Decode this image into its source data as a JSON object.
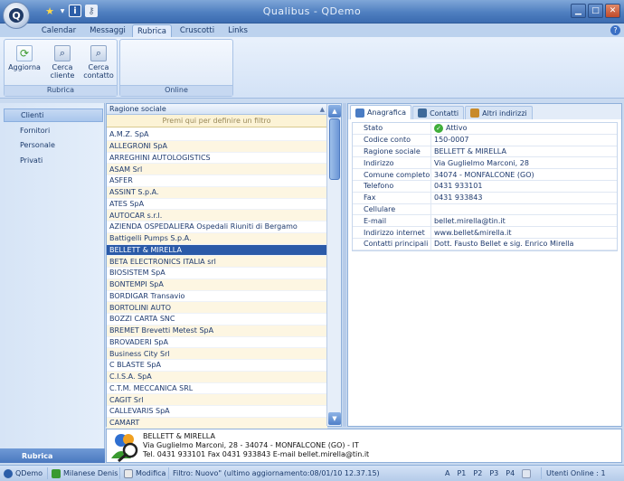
{
  "window": {
    "title": "Qualibus   -   QDemo"
  },
  "menu_tabs": [
    "Calendar",
    "Messaggi",
    "Rubrica",
    "Cruscotti",
    "Links"
  ],
  "ribbon": {
    "group_rubrica": {
      "label": "Rubrica",
      "buttons": [
        "Aggiorna",
        "Cerca cliente",
        "Cerca contatto"
      ]
    },
    "group_online": {
      "label": "Online"
    }
  },
  "nav": {
    "items": [
      "Clienti",
      "Fornitori",
      "Personale",
      "Privati"
    ],
    "footer": "Rubrica"
  },
  "list": {
    "header": "Ragione sociale",
    "filter_placeholder": "Premi qui per definire un filtro",
    "rows": [
      "A.M.Z. SpA",
      "ALLEGRONI SpA",
      "ARREGHINI AUTOLOGISTICS",
      "ASAM Srl",
      "ASFER",
      "ASSINT S.p.A.",
      "ATES SpA",
      "AUTOCAR s.r.l.",
      "AZIENDA OSPEDALIERA Ospedali Riuniti di Bergamo",
      "Battigelli Pumps S.p.A.",
      "BELLETT & MIRELLA",
      "BETA ELECTRONICS ITALIA srl",
      "BIOSISTEM SpA",
      "BONTEMPI SpA",
      "BORDIGAR Transavio",
      "BORTOLINI AUTO",
      "BOZZI CARTA SNC",
      "BREMET Brevetti Metest SpA",
      "BROVADERI SpA",
      "Business City Srl",
      "C BLASTE SpA",
      "C.I.S.A. SpA",
      "C.T.M. MECCANICA SRL",
      "CAGIT Srl",
      "CALLEVARIS SpA",
      "CAMART"
    ],
    "selected_index": 10
  },
  "detail": {
    "tabs": [
      "Anagrafica",
      "Contatti",
      "Altri indirizzi"
    ],
    "props": [
      {
        "k": "Stato",
        "v": "Attivo"
      },
      {
        "k": "Codice conto",
        "v": "150-0007"
      },
      {
        "k": "Ragione sociale",
        "v": "BELLETT & MIRELLA"
      },
      {
        "k": "Indirizzo",
        "v": "Via Guglielmo Marconi, 28"
      },
      {
        "k": "Comune completo",
        "v": "34074 - MONFALCONE (GO)"
      },
      {
        "k": "Telefono",
        "v": "0431 933101"
      },
      {
        "k": "Fax",
        "v": "0431 933843"
      },
      {
        "k": "Cellulare",
        "v": ""
      },
      {
        "k": "E-mail",
        "v": "bellet.mirella@tin.it"
      },
      {
        "k": "Indirizzo internet",
        "v": "www.bellet&mirella.it"
      },
      {
        "k": "Contatti principali",
        "v": "Dott. Fausto Bellet e sig. Enrico Mirella"
      }
    ]
  },
  "info_panel": {
    "line1": "BELLETT & MIRELLA",
    "line2": "Via Guglielmo Marconi, 28 - 34074 - MONFALCONE (GO) - IT",
    "line3": "Tel. 0431 933101 Fax 0431 933843 E-mail bellet.mirella@tin.it"
  },
  "status": {
    "db": "QDemo",
    "user": "Milanese Denis",
    "mode": "Modifica",
    "filter": "Filtro: Nuovo\" (ultimo aggiornamento:08/01/10 12.37.15)",
    "keys": [
      "A",
      "P1",
      "P2",
      "P3",
      "P4"
    ],
    "online": "Utenti Online : 1"
  },
  "colors": {
    "accent": "#2b5aa8",
    "title_bar": "#4f7fc0",
    "row_alt": "#fdf6e2"
  }
}
